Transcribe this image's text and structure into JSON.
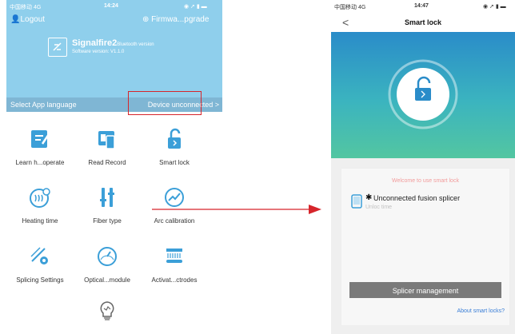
{
  "left": {
    "status": {
      "signal": "中国移动 4G",
      "time": "14:24"
    },
    "logout": "Logout",
    "firmware": "Firmwa...pgrade",
    "app_name": "Signalfire2",
    "app_variant": "Bluetooth version",
    "software_version": "Software version: V1.1.0",
    "language": "Select App language",
    "device_status": "Device unconnected >",
    "tiles": [
      {
        "label": "Learn h...operate",
        "icon": "learn-icon"
      },
      {
        "label": "Read Record",
        "icon": "record-icon"
      },
      {
        "label": "Smart lock",
        "icon": "lock-icon"
      },
      {
        "label": "Heating time",
        "icon": "heating-icon"
      },
      {
        "label": "Fiber type",
        "icon": "fiber-icon"
      },
      {
        "label": "Arc calibration",
        "icon": "arc-icon"
      },
      {
        "label": "Splicing Settings",
        "icon": "splicing-icon"
      },
      {
        "label": "Optical...module",
        "icon": "optical-icon"
      },
      {
        "label": "Activat...ctrodes",
        "icon": "electrode-icon"
      },
      {
        "label": "",
        "icon": "bulb-icon"
      }
    ]
  },
  "right": {
    "status": {
      "signal": "中国移动 4G",
      "time": "14:47"
    },
    "back": "<",
    "title": "Smart lock",
    "welcome": "Welcome to use smart lock",
    "device_name": "Unconnected fusion splicer",
    "device_sub": "Unloc        time",
    "manage_button": "Splicer management",
    "about_link": "About smart locks?"
  },
  "colors": {
    "header": "#8fcfec",
    "accent": "#3b9fd8",
    "highlight": "#d6252b",
    "arrow": "#d6252b"
  }
}
